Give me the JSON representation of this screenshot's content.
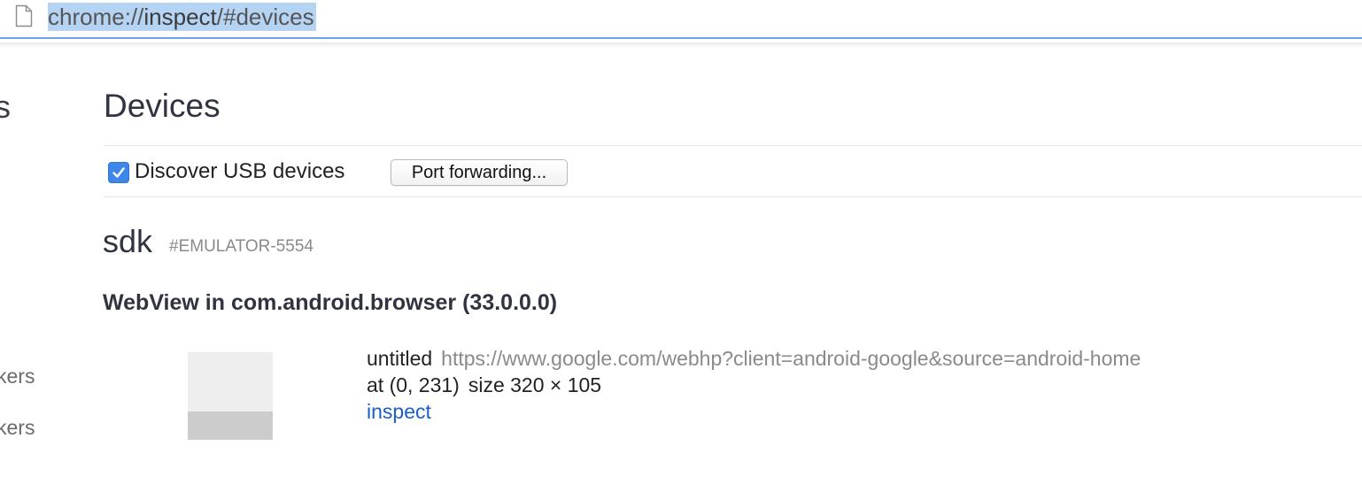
{
  "omnibox": {
    "url_prefix": "chrome://",
    "url_host": "inspect",
    "url_suffix": "/#devices",
    "icon": "page-icon"
  },
  "sidebar": {
    "heading_fragment": "s",
    "items": [
      {
        "label": "kers"
      },
      {
        "label": "kers"
      }
    ]
  },
  "main": {
    "title": "Devices",
    "discover_usb": {
      "label": "Discover USB devices",
      "checked": true
    },
    "port_forwarding_label": "Port forwarding...",
    "device": {
      "name": "sdk",
      "serial": "#EMULATOR-5554",
      "browser": {
        "title": "WebView in com.android.browser (33.0.0.0)",
        "target": {
          "name": "untitled",
          "url": "https://www.google.com/webhp?client=android-google&source=android-home",
          "position": "at (0, 231)",
          "size": "size 320 × 105",
          "inspect_label": "inspect"
        }
      }
    }
  },
  "colors": {
    "accent": "#3e87e8",
    "link": "#1a5fc8",
    "url_selection": "#b5d3f3"
  }
}
